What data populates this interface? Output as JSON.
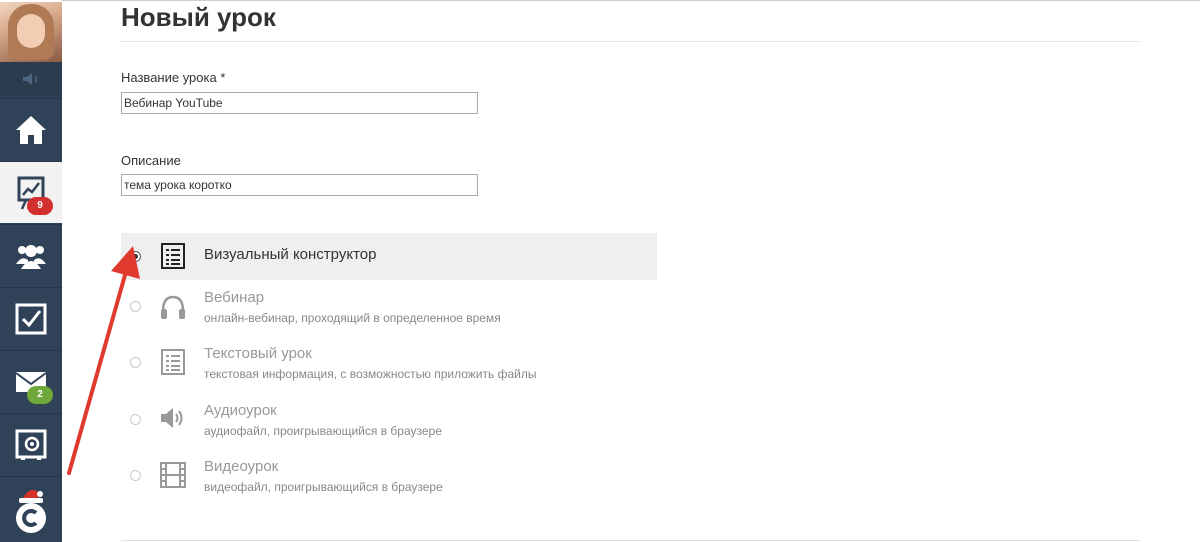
{
  "page": {
    "title": "Новый урок"
  },
  "form": {
    "name_label": "Название урока *",
    "name_value": "Вебинар YouTube",
    "desc_label": "Описание",
    "desc_value": "тема урока коротко"
  },
  "sidebar": {
    "badges": {
      "stats": "9",
      "mail": "2"
    }
  },
  "lesson_types": [
    {
      "title": "Визуальный конструктор",
      "desc": "",
      "icon": "list-icon",
      "selected": true
    },
    {
      "title": "Вебинар",
      "desc": "онлайн-вебинар, проходящий в определенное время",
      "icon": "headphones-icon",
      "selected": false
    },
    {
      "title": "Текстовый урок",
      "desc": "текстовая информация, с возможностью приложить файлы",
      "icon": "text-list-icon",
      "selected": false
    },
    {
      "title": "Аудиоурок",
      "desc": "аудиофайл, проигрывающийся в браузере",
      "icon": "speaker-icon",
      "selected": false
    },
    {
      "title": "Видеоурок",
      "desc": "видеофайл, проигрывающийся в браузере",
      "icon": "film-icon",
      "selected": false
    }
  ],
  "colors": {
    "sidebar": "#2f4257",
    "arrow": "#e03a2f",
    "badge_red": "#d22f2f",
    "badge_green": "#6fa83a"
  }
}
